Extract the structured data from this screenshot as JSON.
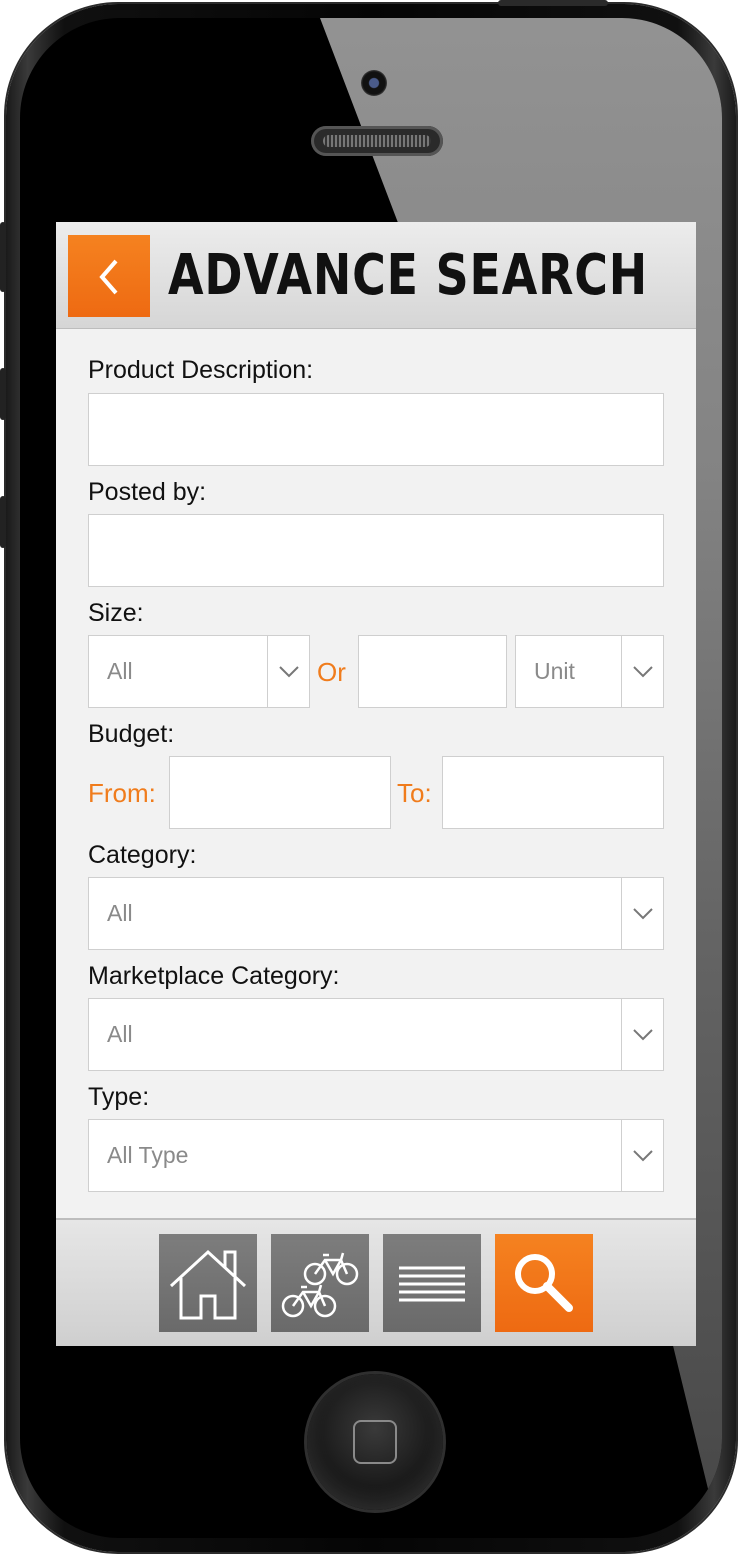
{
  "header": {
    "title": "ADVANCE SEARCH",
    "back_icon": "chevron-left-icon"
  },
  "form": {
    "product_description_label": "Product Description:",
    "product_description_value": "",
    "posted_by_label": "Posted by:",
    "posted_by_value": "",
    "size_label": "Size:",
    "size_select_value": "All",
    "size_or_text": "Or",
    "size_custom_value": "",
    "size_unit_value": "Unit",
    "budget_label": "Budget:",
    "budget_from_label": "From:",
    "budget_from_value": "",
    "budget_to_label": "To:",
    "budget_to_value": "",
    "category_label": "Category:",
    "category_value": "All",
    "marketplace_category_label": "Marketplace Category:",
    "marketplace_category_value": "All",
    "type_label": "Type:",
    "type_value": "All Type"
  },
  "tabs": [
    {
      "icon": "home-icon",
      "active": false
    },
    {
      "icon": "bicycles-icon",
      "active": false
    },
    {
      "icon": "list-icon",
      "active": false
    },
    {
      "icon": "search-icon",
      "active": true
    }
  ],
  "colors": {
    "accent": "#f07c1c",
    "tab_inactive": "#737373",
    "screen_background": "#f2f2f2"
  }
}
